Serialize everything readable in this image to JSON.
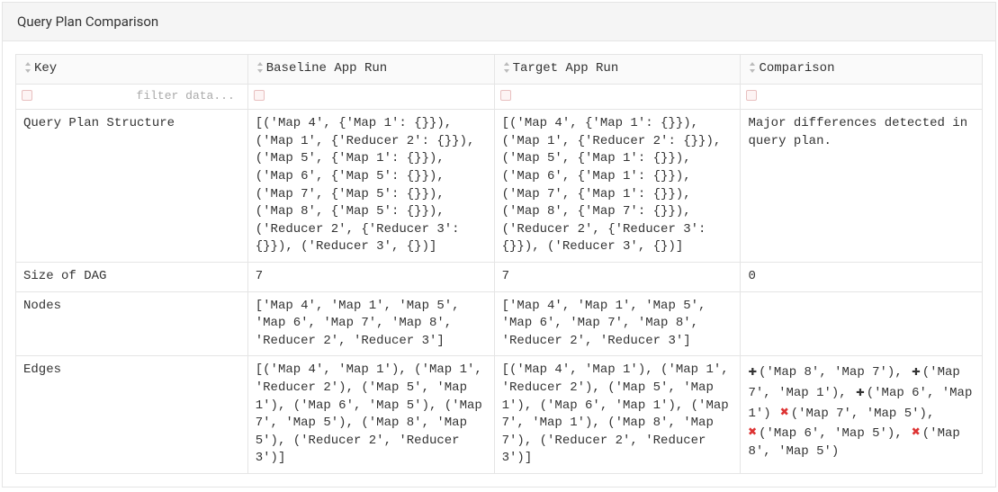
{
  "panel": {
    "title": "Query Plan Comparison"
  },
  "columns": {
    "key": "Key",
    "baseline": "Baseline App Run",
    "target": "Target App Run",
    "comparison": "Comparison"
  },
  "filter": {
    "placeholder": "filter data..."
  },
  "rows": [
    {
      "key": "Query Plan Structure",
      "baseline": "[('Map 4', {'Map 1': {}}), ('Map 1', {'Reducer 2': {}}), ('Map 5', {'Map 1': {}}), ('Map 6', {'Map 5': {}}), ('Map 7', {'Map 5': {}}), ('Map 8', {'Map 5': {}}), ('Reducer 2', {'Reducer 3': {}}), ('Reducer 3', {})]",
      "target": "[('Map 4', {'Map 1': {}}), ('Map 1', {'Reducer 2': {}}), ('Map 5', {'Map 1': {}}), ('Map 6', {'Map 1': {}}), ('Map 7', {'Map 1': {}}), ('Map 8', {'Map 7': {}}), ('Reducer 2', {'Reducer 3': {}}), ('Reducer 3', {})]",
      "comparison": "Major differences detected in query plan."
    },
    {
      "key": "Size of DAG",
      "baseline": "7",
      "target": "7",
      "comparison": "0"
    },
    {
      "key": "Nodes",
      "baseline": "['Map 4', 'Map 1', 'Map 5', 'Map 6', 'Map 7', 'Map 8', 'Reducer 2', 'Reducer 3']",
      "target": "['Map 4', 'Map 1', 'Map 5', 'Map 6', 'Map 7', 'Map 8', 'Reducer 2', 'Reducer 3']",
      "comparison": ""
    },
    {
      "key": "Edges",
      "baseline": "[('Map 4', 'Map 1'), ('Map 1', 'Reducer 2'), ('Map 5', 'Map 1'), ('Map 6', 'Map 5'), ('Map 7', 'Map 5'), ('Map 8', 'Map 5'), ('Reducer 2', 'Reducer 3')]",
      "target": "[('Map 4', 'Map 1'), ('Map 1', 'Reducer 2'), ('Map 5', 'Map 1'), ('Map 6', 'Map 1'), ('Map 7', 'Map 1'), ('Map 8', 'Map 7'), ('Reducer 2', 'Reducer 3')]",
      "comparison_diff": [
        {
          "type": "add",
          "text": "('Map 8', 'Map 7'), "
        },
        {
          "type": "add",
          "text": "('Map 7', 'Map 1'), "
        },
        {
          "type": "add",
          "text": "('Map 6', 'Map 1') "
        },
        {
          "type": "remove",
          "text": "('Map 7', 'Map 5'), "
        },
        {
          "type": "remove",
          "text": "('Map 6', 'Map 5'), "
        },
        {
          "type": "remove",
          "text": "('Map 8', 'Map 5')"
        }
      ]
    }
  ]
}
